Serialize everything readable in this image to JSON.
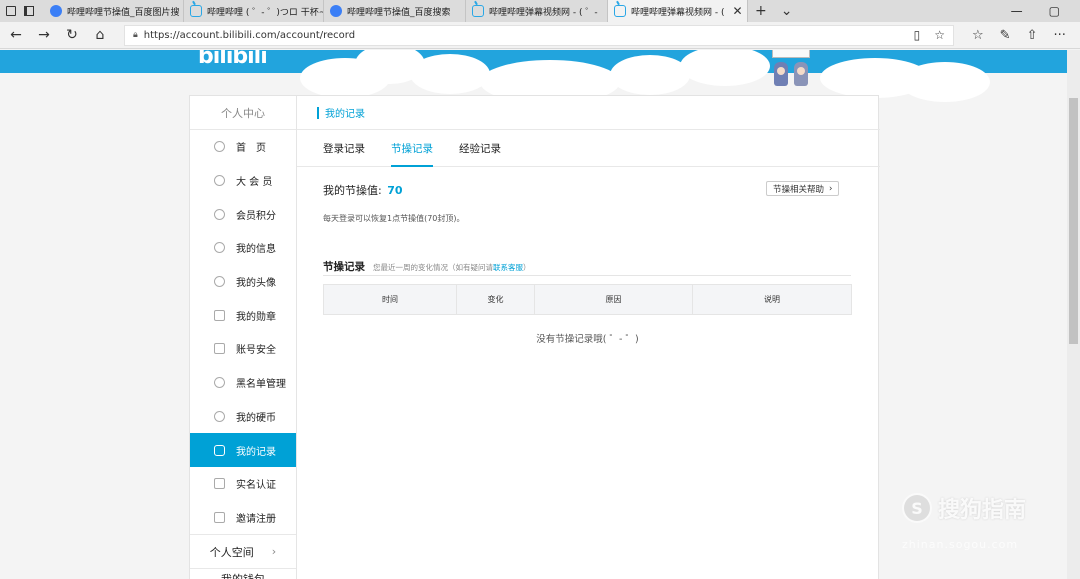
{
  "browser": {
    "tabs": [
      {
        "title": "哔哩哔哩节操值_百度图片搜",
        "icon": "baidu-icon"
      },
      {
        "title": "哔哩哔哩 ( ゜- ゜)つロ 干杯~",
        "icon": "bilibili-icon"
      },
      {
        "title": "哔哩哔哩节操值_百度搜索",
        "icon": "baidu-icon"
      },
      {
        "title": "哔哩哔哩弹幕视频网 - ( ゜-",
        "icon": "bilibili-icon"
      },
      {
        "title": "哔哩哔哩弹幕视频网 - (",
        "icon": "bilibili-icon",
        "active": true
      }
    ],
    "new_tab": "+",
    "tab_close": "✕",
    "url": "https://account.bilibili.com/account/record"
  },
  "site": {
    "logo": "bilibili",
    "accent_color": "#00a1d6"
  },
  "sidebar": {
    "header": "个人中心",
    "items": [
      {
        "label": "首　页",
        "icon": "home-icon"
      },
      {
        "label": "大 会 员",
        "icon": "vip-icon"
      },
      {
        "label": "会员积分",
        "icon": "points-icon"
      },
      {
        "label": "我的信息",
        "icon": "user-icon"
      },
      {
        "label": "我的头像",
        "icon": "avatar-icon"
      },
      {
        "label": "我的勋章",
        "icon": "medal-icon"
      },
      {
        "label": "账号安全",
        "icon": "shield-icon"
      },
      {
        "label": "黑名单管理",
        "icon": "blacklist-icon"
      },
      {
        "label": "我的硬币",
        "icon": "coin-icon"
      },
      {
        "label": "我的记录",
        "icon": "record-icon",
        "active": true
      },
      {
        "label": "实名认证",
        "icon": "id-card-icon"
      },
      {
        "label": "邀请注册",
        "icon": "invite-icon"
      }
    ],
    "space": "个人空间",
    "more": "我的钱包"
  },
  "main": {
    "title": "我的记录",
    "tabs": [
      {
        "label": "登录记录"
      },
      {
        "label": "节操记录",
        "active": true
      },
      {
        "label": "经验记录"
      }
    ],
    "score_label": "我的节操值:",
    "score_value": "70",
    "help_button": "节操相关帮助",
    "description": "每天登录可以恢复1点节操值(70封顶)。",
    "records": {
      "title": "节操记录",
      "subtitle": "您最近一周的变化情况（如有疑问请",
      "link": "联系客服",
      "subtitle_end": "）",
      "columns": [
        "时间",
        "变化",
        "原因",
        "说明"
      ],
      "empty": "没有节操记录哦( ゜- ゜)"
    }
  },
  "watermark": {
    "logo_glyph": "S",
    "text": "搜狗指南",
    "url": "zhinan.sogou.com"
  }
}
